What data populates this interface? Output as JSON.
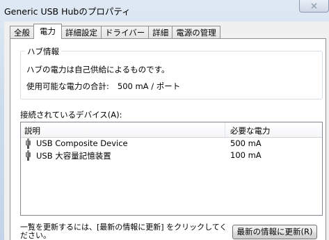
{
  "window": {
    "title": "Generic USB Hubのプロパティ"
  },
  "tabs": [
    {
      "label": "全般"
    },
    {
      "label": "電力"
    },
    {
      "label": "詳細設定"
    },
    {
      "label": "ドライバー"
    },
    {
      "label": "詳細"
    },
    {
      "label": "電源の管理"
    }
  ],
  "hub_info": {
    "group_title": "ハブ情報",
    "self_powered_text": "ハブの電力は自己供給によるものです。",
    "total_power_label": "使用可能な電力の合計:",
    "total_power_value": "500 mA / ポート"
  },
  "devices": {
    "label": "接続されているデバイス(A):",
    "columns": {
      "description": "説明",
      "required_power": "必要な電力"
    },
    "rows": [
      {
        "name": "USB Composite Device",
        "power": "500 mA",
        "icon": "usb-plug-icon"
      },
      {
        "name": "USB 大容量記憶装置",
        "power": "100 mA",
        "icon": "usb-plug-icon"
      }
    ]
  },
  "footer": {
    "hint": "一覧を更新するには、[最新の情報に更新] をクリックしてください。",
    "refresh_button": "最新の情報に更新(R)"
  }
}
